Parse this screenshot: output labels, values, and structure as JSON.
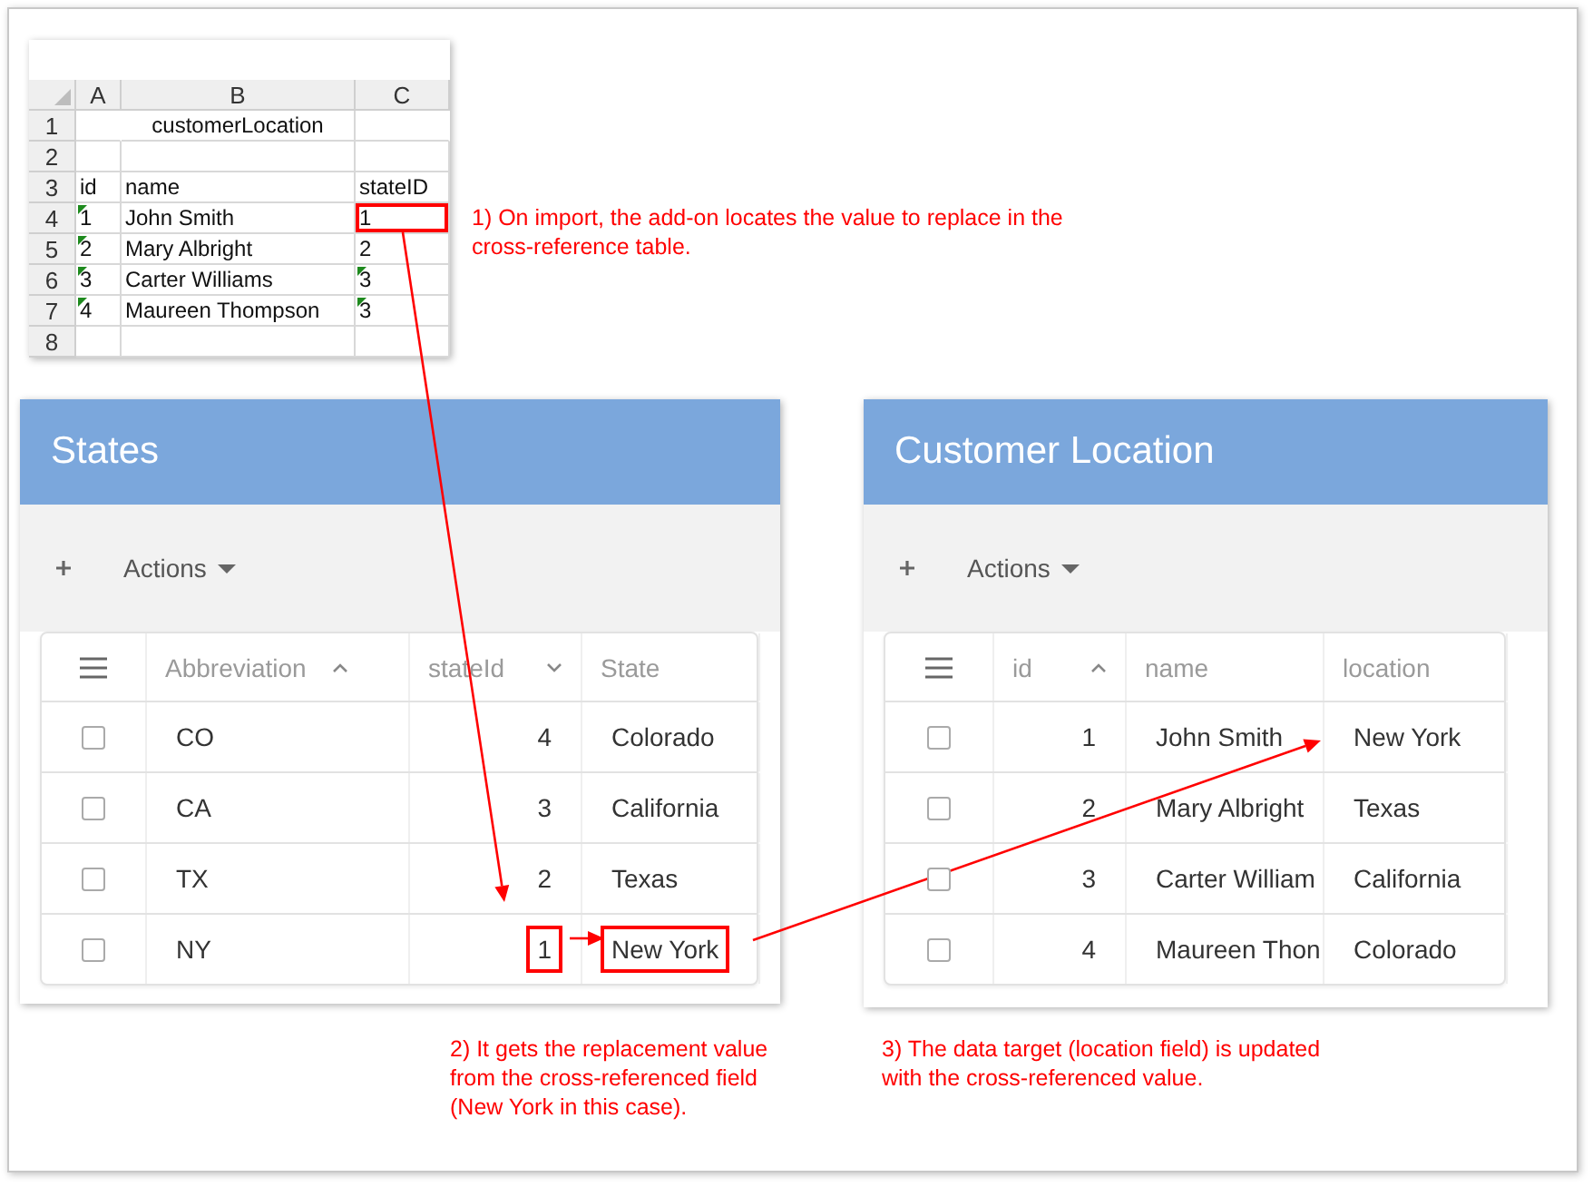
{
  "spreadsheet": {
    "columns": [
      "A",
      "B",
      "C"
    ],
    "rows": [
      {
        "number": "1",
        "kind": "title",
        "cells": [
          {
            "text": "",
            "flag": false,
            "highlighted": false
          },
          {
            "text": "customerLocation",
            "flag": false,
            "highlighted": false
          },
          {
            "text": "",
            "flag": false,
            "highlighted": false
          }
        ]
      },
      {
        "number": "2",
        "kind": "data",
        "cells": [
          {
            "text": "",
            "flag": false,
            "highlighted": false
          },
          {
            "text": "",
            "flag": false,
            "highlighted": false
          },
          {
            "text": "",
            "flag": false,
            "highlighted": false
          }
        ]
      },
      {
        "number": "3",
        "kind": "data",
        "cells": [
          {
            "text": "id",
            "flag": false,
            "highlighted": false
          },
          {
            "text": "name",
            "flag": false,
            "highlighted": false
          },
          {
            "text": "stateID",
            "flag": false,
            "highlighted": false
          }
        ]
      },
      {
        "number": "4",
        "kind": "data",
        "cells": [
          {
            "text": "1",
            "flag": true,
            "highlighted": false
          },
          {
            "text": "John Smith",
            "flag": false,
            "highlighted": false
          },
          {
            "text": "1",
            "flag": false,
            "highlighted": true
          }
        ]
      },
      {
        "number": "5",
        "kind": "data",
        "cells": [
          {
            "text": "2",
            "flag": true,
            "highlighted": false
          },
          {
            "text": "Mary Albright",
            "flag": false,
            "highlighted": false
          },
          {
            "text": "2",
            "flag": false,
            "highlighted": false
          }
        ]
      },
      {
        "number": "6",
        "kind": "data",
        "cells": [
          {
            "text": "3",
            "flag": true,
            "highlighted": false
          },
          {
            "text": "Carter Williams",
            "flag": false,
            "highlighted": false
          },
          {
            "text": "3",
            "flag": true,
            "highlighted": false
          }
        ]
      },
      {
        "number": "7",
        "kind": "data",
        "cells": [
          {
            "text": "4",
            "flag": true,
            "highlighted": false
          },
          {
            "text": "Maureen Thompson",
            "flag": false,
            "highlighted": false
          },
          {
            "text": "3",
            "flag": true,
            "highlighted": false
          }
        ]
      },
      {
        "number": "8",
        "kind": "data",
        "cells": [
          {
            "text": "",
            "flag": false,
            "highlighted": false
          },
          {
            "text": "",
            "flag": false,
            "highlighted": false
          },
          {
            "text": "",
            "flag": false,
            "highlighted": false
          }
        ]
      }
    ]
  },
  "panels": [
    {
      "title": "States",
      "actions": "Actions",
      "columns": [
        {
          "label": "Abbreviation",
          "sort_ascending": true,
          "sort_descending": false,
          "kind": "text"
        },
        {
          "label": "stateId",
          "sort_ascending": false,
          "sort_descending": true,
          "kind": "number"
        },
        {
          "label": "State",
          "sort_ascending": false,
          "sort_descending": false,
          "kind": "text"
        }
      ],
      "rows": [
        {
          "checked": false,
          "cells": [
            {
              "text": "CO",
              "highlighted": false
            },
            {
              "text": "4",
              "highlighted": false
            },
            {
              "text": "Colorado",
              "highlighted": false
            }
          ]
        },
        {
          "checked": false,
          "cells": [
            {
              "text": "CA",
              "highlighted": false
            },
            {
              "text": "3",
              "highlighted": false
            },
            {
              "text": "California",
              "highlighted": false
            }
          ]
        },
        {
          "checked": false,
          "cells": [
            {
              "text": "TX",
              "highlighted": false
            },
            {
              "text": "2",
              "highlighted": false
            },
            {
              "text": "Texas",
              "highlighted": false
            }
          ]
        },
        {
          "checked": false,
          "cells": [
            {
              "text": "NY",
              "highlighted": false
            },
            {
              "text": "1",
              "highlighted": true
            },
            {
              "text": "New York",
              "highlighted": true
            }
          ]
        }
      ]
    },
    {
      "title": "Customer Location",
      "actions": "Actions",
      "columns": [
        {
          "label": "id",
          "sort_ascending": true,
          "sort_descending": false,
          "kind": "number"
        },
        {
          "label": "name",
          "sort_ascending": false,
          "sort_descending": false,
          "kind": "text"
        },
        {
          "label": "location",
          "sort_ascending": false,
          "sort_descending": false,
          "kind": "text"
        }
      ],
      "rows": [
        {
          "checked": false,
          "cells": [
            {
              "text": "1",
              "highlighted": false
            },
            {
              "text": "John Smith",
              "highlighted": false
            },
            {
              "text": "New York",
              "highlighted": false
            }
          ]
        },
        {
          "checked": false,
          "cells": [
            {
              "text": "2",
              "highlighted": false
            },
            {
              "text": "Mary Albright",
              "highlighted": false
            },
            {
              "text": "Texas",
              "highlighted": false
            }
          ]
        },
        {
          "checked": false,
          "cells": [
            {
              "text": "3",
              "highlighted": false
            },
            {
              "text": "Carter William",
              "highlighted": false
            },
            {
              "text": "California",
              "highlighted": false
            }
          ]
        },
        {
          "checked": false,
          "cells": [
            {
              "text": "4",
              "highlighted": false
            },
            {
              "text": "Maureen Thon",
              "highlighted": false
            },
            {
              "text": "Colorado",
              "highlighted": false
            }
          ]
        }
      ]
    }
  ],
  "annotations": [
    "1) On import, the add-on locates the value to replace in the cross-reference table.",
    "2) It gets the replacement value from the cross-referenced field (New York in this case).",
    "3) The data target (location field) is updated with the cross-referenced value."
  ]
}
